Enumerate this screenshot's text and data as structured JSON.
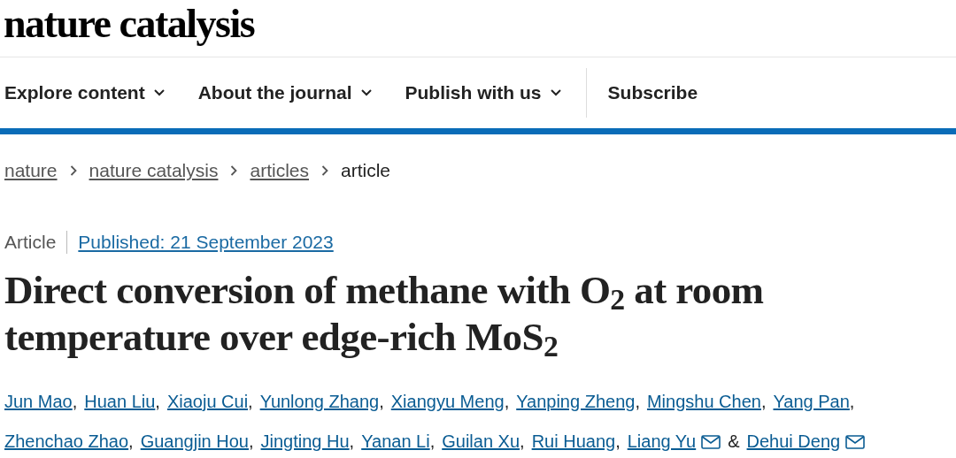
{
  "logo": "nature catalysis",
  "nav": [
    {
      "label": "Explore content",
      "dropdown": true
    },
    {
      "label": "About the journal",
      "dropdown": true
    },
    {
      "label": "Publish with us",
      "dropdown": true
    },
    {
      "label": "Subscribe",
      "dropdown": false
    }
  ],
  "breadcrumb": [
    {
      "label": "nature",
      "link": true
    },
    {
      "label": "nature catalysis",
      "link": true
    },
    {
      "label": "articles",
      "link": true
    },
    {
      "label": "article",
      "link": false
    }
  ],
  "article": {
    "type": "Article",
    "published": "Published: 21 September 2023",
    "title": "Direct conversion of methane with O$_{2}$ at room temperature over edge-rich MoS$_{2}$",
    "authors": [
      {
        "name": "Jun Mao",
        "email": false,
        "separator": ","
      },
      {
        "name": "Huan Liu",
        "email": false,
        "separator": ","
      },
      {
        "name": "Xiaoju Cui",
        "email": false,
        "separator": ","
      },
      {
        "name": "Yunlong Zhang",
        "email": false,
        "separator": ","
      },
      {
        "name": "Xiangyu Meng",
        "email": false,
        "separator": ","
      },
      {
        "name": "Yanping Zheng",
        "email": false,
        "separator": ","
      },
      {
        "name": "Mingshu Chen",
        "email": false,
        "separator": ","
      },
      {
        "name": "Yang Pan",
        "email": false,
        "separator": ","
      },
      {
        "name": "Zhenchao Zhao",
        "email": false,
        "separator": ","
      },
      {
        "name": "Guangjin Hou",
        "email": false,
        "separator": ","
      },
      {
        "name": "Jingting Hu",
        "email": false,
        "separator": ","
      },
      {
        "name": "Yanan Li",
        "email": false,
        "separator": ","
      },
      {
        "name": "Guilan Xu",
        "email": false,
        "separator": ","
      },
      {
        "name": "Rui Huang",
        "email": false,
        "separator": ","
      },
      {
        "name": "Liang Yu",
        "email": true,
        "separator": "&"
      },
      {
        "name": "Dehui Deng",
        "email": true
      }
    ]
  }
}
